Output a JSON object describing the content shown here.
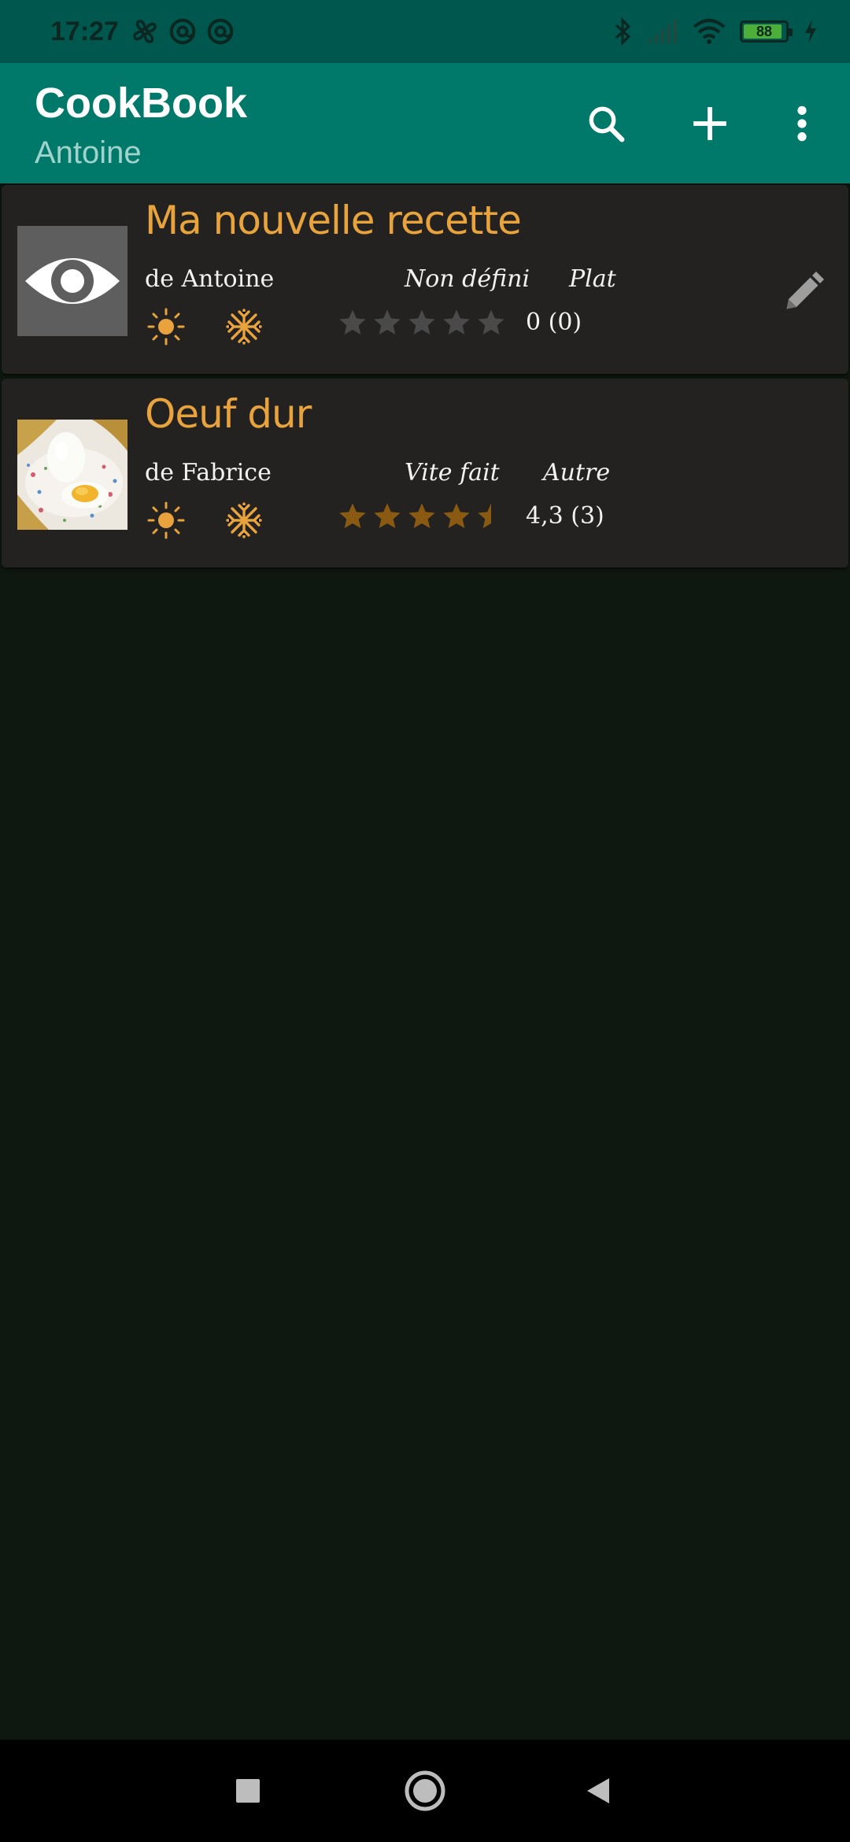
{
  "status_bar": {
    "time": "17:27",
    "battery": "88"
  },
  "app_bar": {
    "title": "CookBook",
    "subtitle": "Antoine"
  },
  "recipes": [
    {
      "title": "Ma nouvelle recette",
      "author": "de Antoine",
      "duration": "Non défini",
      "category": "Plat",
      "rating": 0,
      "rating_text": "0 (0)",
      "thumbnail": "eye-placeholder",
      "editable": true
    },
    {
      "title": "Oeuf dur",
      "author": "de Fabrice",
      "duration": "Vite fait",
      "category": "Autre",
      "rating": 4.3,
      "rating_text": "4,3 (3)",
      "thumbnail": "boiled-egg-photo",
      "editable": false
    }
  ],
  "colors": {
    "status_bar": "#00574e",
    "app_bar": "#00796b",
    "background": "#0e1810",
    "card": "#232220",
    "accent": "#e8a33c",
    "star_filled": "#8a5a12",
    "star_empty": "#4a4a4a"
  }
}
